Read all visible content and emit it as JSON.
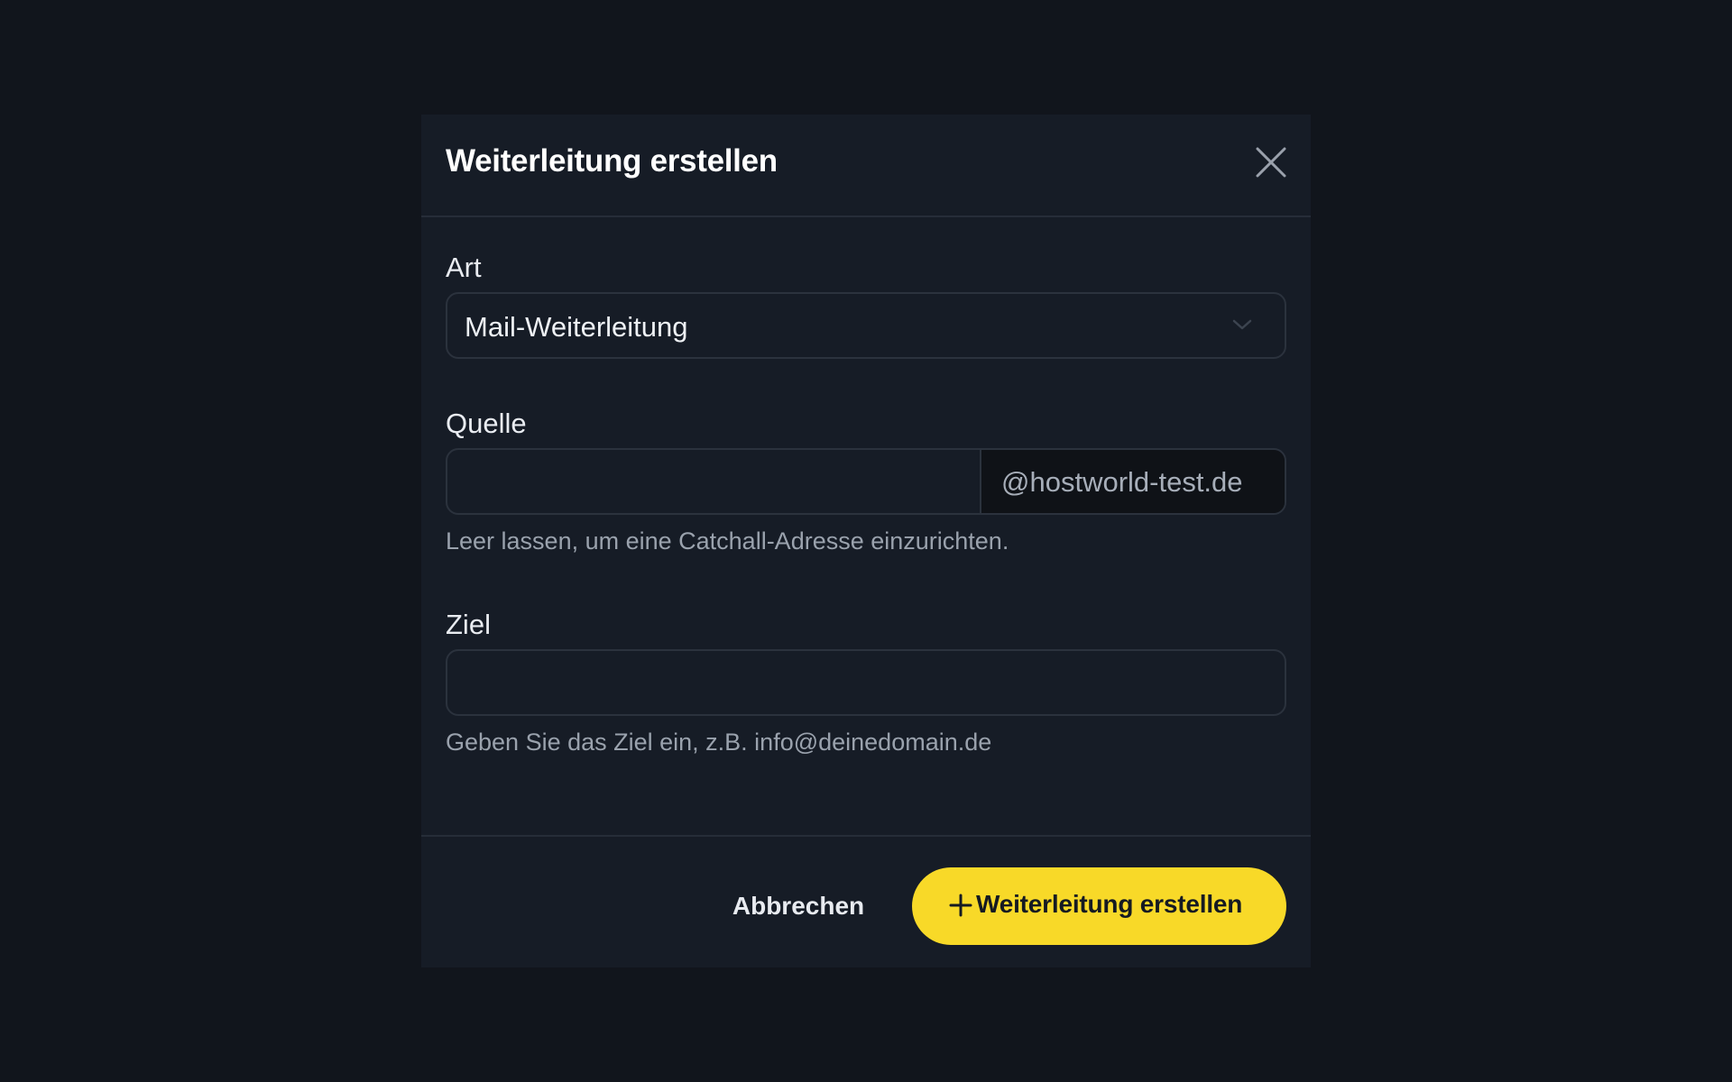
{
  "dialog": {
    "title": "Weiterleitung erstellen",
    "close_icon": "close-icon"
  },
  "form": {
    "type": {
      "label": "Art",
      "selected": "Mail-Weiterleitung",
      "icon": "chevron-down-icon"
    },
    "source": {
      "label": "Quelle",
      "value": "",
      "placeholder": "",
      "domain_suffix": "@hostworld-test.de",
      "helper": "Leer lassen, um eine Catchall-Adresse einzurichten."
    },
    "target": {
      "label": "Ziel",
      "value": "",
      "placeholder": "",
      "helper": "Geben Sie das Ziel ein, z.B. info@deinedomain.de"
    }
  },
  "footer": {
    "cancel_label": "Abbrechen",
    "submit_label": "Weiterleitung erstellen",
    "submit_icon": "plus-icon"
  },
  "colors": {
    "backdrop": "#11151c",
    "modal_bg": "#161c26",
    "accent": "#f8d928",
    "border": "#2b323d"
  }
}
